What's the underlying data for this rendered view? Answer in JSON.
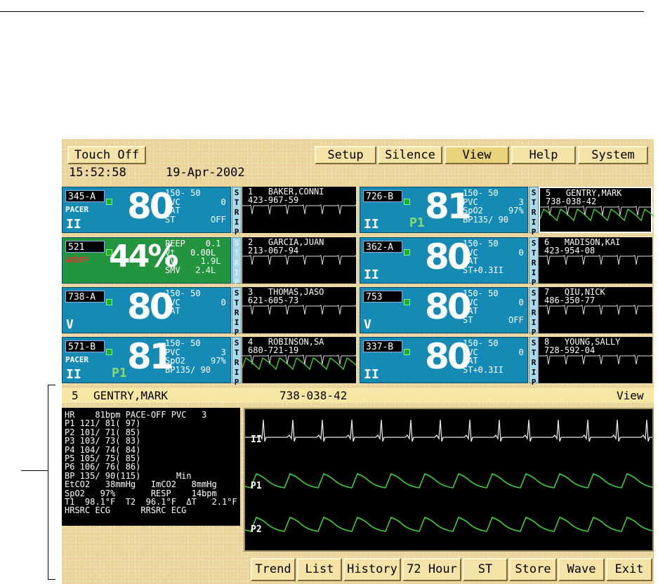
{
  "toolbar": {
    "touch_off": "Touch Off",
    "setup": "Setup",
    "silence": "Silence",
    "view": "View",
    "help": "Help",
    "system": "System"
  },
  "clock": {
    "time": "15:52:58",
    "date": "19-Apr-2002"
  },
  "tiles": [
    {
      "bed": "345-A",
      "tag": "PACER",
      "lead": "II",
      "value": "80",
      "p1": "",
      "l1": "150- 50",
      "l2": "PVC        0",
      "l3": "BAT",
      "l4": "ST       OFF",
      "strip": [
        "S",
        "T",
        "R",
        "I",
        "P"
      ],
      "num": "1",
      "name": "BAKER,CONNI",
      "id": "423-967-59"
    },
    {
      "bed": "521",
      "tag": "AROFF",
      "lead": "",
      "value": "44%",
      "p1": "",
      "l1": "PEEP    0.1",
      "l2": "Vt   0.00L",
      "l3": "MV     1.9L",
      "l4": "SMV   2.4L",
      "strip": [
        "S",
        "T",
        "R",
        "I",
        "P"
      ],
      "num": "2",
      "name": "GARCIA,JUAN",
      "id": "213-067-94"
    },
    {
      "bed": "738-A",
      "tag": "",
      "lead": "V",
      "value": "80",
      "p1": "",
      "l1": "150- 50",
      "l2": "PVC        0",
      "l3": "BAT",
      "l4": "",
      "strip": [
        "S",
        "T",
        "R",
        "I",
        "P"
      ],
      "num": "3",
      "name": "THOMAS,JASO",
      "id": "621-605-73"
    },
    {
      "bed": "571-B",
      "tag": "PACER",
      "lead": "II",
      "value": "81",
      "p1": "P1",
      "l1": "150- 50",
      "l2": "PVC        3",
      "l3": "SpO2     97%",
      "l4": "BP135/ 90",
      "strip": [
        "S",
        "T",
        "R",
        "I",
        "P"
      ],
      "num": "4",
      "name": "ROBINSON,SA",
      "id": "680-721-19"
    },
    {
      "bed": "726-B",
      "tag": "",
      "lead": "II",
      "value": "81",
      "p1": "P1",
      "l1": "150- 50",
      "l2": "PVC        3",
      "l3": "SpO2     97%",
      "l4": "BP135/ 90",
      "strip": [
        "S",
        "T",
        "R",
        "I",
        "P"
      ],
      "num": "5",
      "name": "GENTRY,MARK",
      "id": "738-038-42"
    },
    {
      "bed": "362-A",
      "tag": "",
      "lead": "II",
      "value": "80",
      "p1": "",
      "l1": "150- 50",
      "l2": "PVC        0",
      "l3": "BAT",
      "l4": "ST+0.3II",
      "strip": [
        "S",
        "T",
        "R",
        "I",
        "P"
      ],
      "num": "6",
      "name": "MADISON,KAI",
      "id": "423-954-08"
    },
    {
      "bed": "753",
      "tag": "",
      "lead": "V",
      "value": "80",
      "p1": "",
      "l1": "150- 50",
      "l2": "PVC        0",
      "l3": "BAT",
      "l4": "ST       OFF",
      "strip": [
        "S",
        "T",
        "R",
        "I",
        "P"
      ],
      "num": "7",
      "name": "QIU,NICK",
      "id": "486-350-77"
    },
    {
      "bed": "337-B",
      "tag": "",
      "lead": "II",
      "value": "80",
      "p1": "",
      "l1": "150- 50",
      "l2": "PVC        0",
      "l3": "BAT",
      "l4": "ST+0.3II",
      "strip": [
        "S",
        "T",
        "R",
        "I",
        "P"
      ],
      "num": "8",
      "name": "YOUNG,SALLY",
      "id": "728-592-04"
    }
  ],
  "info_bar": {
    "num": "5",
    "name": "GENTRY,MARK",
    "id": "738-038-42",
    "view": "View"
  },
  "vitals": [
    "HR    81bpm PACE-OFF PVC   3",
    "P1 121/ 81( 97)",
    "P2 101/ 71( 85)",
    "P3 103/ 73( 83)",
    "P4 104/ 74( 84)",
    "P5 105/ 75( 85)",
    "P6 106/ 76( 86)",
    "BP 135/ 90(115)       Min",
    "EtCO2   38mmHg   ImCO2   8mmHg",
    "SpO2   97%       RESP    14bpm",
    "T1  98.1°F  T2  96.1°F  ΔT   2.1°F",
    "HRSRC ECG      RRSRC ECG"
  ],
  "waves": {
    "ecg": "II",
    "p1": "P1",
    "p2": "P2"
  },
  "bottom_buttons": {
    "trend": "Trend",
    "list": "List",
    "history": "History",
    "hour72": "72 Hour",
    "st": "ST",
    "store": "Store",
    "wave": "Wave",
    "exit": "Exit"
  },
  "colors": {
    "tile_blue": "#148ab5",
    "tile_green": "#22953e",
    "wave_green": "#3fd43a",
    "panel_tan": "#ecd8a2"
  }
}
